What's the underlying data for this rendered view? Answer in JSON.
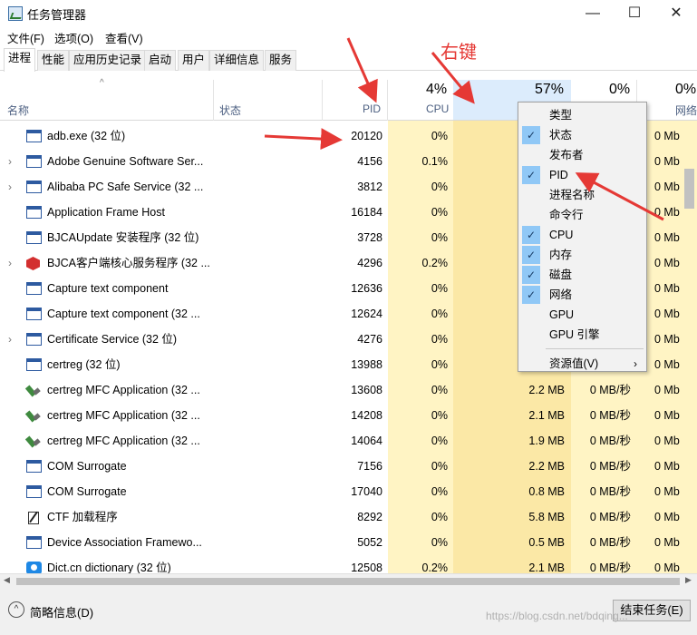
{
  "window": {
    "title": "任务管理器",
    "minimize_glyph": "—",
    "maximize_glyph": "☐",
    "close_glyph": "✕"
  },
  "menu": [
    "文件(F)",
    "选项(O)",
    "查看(V)"
  ],
  "tabs": [
    "进程",
    "性能",
    "应用历史记录",
    "启动",
    "用户",
    "详细信息",
    "服务"
  ],
  "columns": {
    "name": "名称",
    "status": "状态",
    "pid": "PID",
    "cpu_pct": "4%",
    "cpu": "CPU",
    "mem_pct": "57%",
    "disk_pct": "0%",
    "net_pct": "0%",
    "net": "网络"
  },
  "processes": [
    {
      "name": "adb.exe (32 位)",
      "pid": "20120",
      "cpu": "0%",
      "mem": "",
      "disk": "",
      "net": "0 Mb",
      "expandable": false,
      "icon": "window"
    },
    {
      "name": "Adobe Genuine Software Ser...",
      "pid": "4156",
      "cpu": "0.1%",
      "mem": "",
      "disk": "",
      "net": "0 Mb",
      "expandable": true,
      "icon": "window"
    },
    {
      "name": "Alibaba PC Safe Service (32 ...",
      "pid": "3812",
      "cpu": "0%",
      "mem": "",
      "disk": "",
      "net": "0 Mb",
      "expandable": true,
      "icon": "window"
    },
    {
      "name": "Application Frame Host",
      "pid": "16184",
      "cpu": "0%",
      "mem": "",
      "disk": "",
      "net": "0 Mb",
      "expandable": false,
      "icon": "window"
    },
    {
      "name": "BJCAUpdate 安装程序 (32 位)",
      "pid": "3728",
      "cpu": "0%",
      "mem": "",
      "disk": "",
      "net": "0 Mb",
      "expandable": false,
      "icon": "window"
    },
    {
      "name": "BJCA客户端核心服务程序 (32 ...",
      "pid": "4296",
      "cpu": "0.2%",
      "mem": "",
      "disk": "",
      "net": "0 Mb",
      "expandable": true,
      "icon": "red"
    },
    {
      "name": "Capture text component",
      "pid": "12636",
      "cpu": "0%",
      "mem": "",
      "disk": "",
      "net": "0 Mb",
      "expandable": false,
      "icon": "window"
    },
    {
      "name": "Capture text component (32 ...",
      "pid": "12624",
      "cpu": "0%",
      "mem": "",
      "disk": "",
      "net": "0 Mb",
      "expandable": false,
      "icon": "window"
    },
    {
      "name": "Certificate Service (32 位)",
      "pid": "4276",
      "cpu": "0%",
      "mem": "",
      "disk": "",
      "net": "0 Mb",
      "expandable": true,
      "icon": "window"
    },
    {
      "name": "certreg (32 位)",
      "pid": "13988",
      "cpu": "0%",
      "mem": "",
      "disk": "",
      "net": "0 Mb",
      "expandable": false,
      "icon": "window"
    },
    {
      "name": "certreg MFC Application (32 ...",
      "pid": "13608",
      "cpu": "0%",
      "mem": "2.2 MB",
      "disk": "0 MB/秒",
      "net": "0 Mb",
      "expandable": false,
      "icon": "tool"
    },
    {
      "name": "certreg MFC Application (32 ...",
      "pid": "14208",
      "cpu": "0%",
      "mem": "2.1 MB",
      "disk": "0 MB/秒",
      "net": "0 Mb",
      "expandable": false,
      "icon": "tool"
    },
    {
      "name": "certreg MFC Application (32 ...",
      "pid": "14064",
      "cpu": "0%",
      "mem": "1.9 MB",
      "disk": "0 MB/秒",
      "net": "0 Mb",
      "expandable": false,
      "icon": "tool"
    },
    {
      "name": "COM Surrogate",
      "pid": "7156",
      "cpu": "0%",
      "mem": "2.2 MB",
      "disk": "0 MB/秒",
      "net": "0 Mb",
      "expandable": false,
      "icon": "window"
    },
    {
      "name": "COM Surrogate",
      "pid": "17040",
      "cpu": "0%",
      "mem": "0.8 MB",
      "disk": "0 MB/秒",
      "net": "0 Mb",
      "expandable": false,
      "icon": "window"
    },
    {
      "name": "CTF 加载程序",
      "pid": "8292",
      "cpu": "0%",
      "mem": "5.8 MB",
      "disk": "0 MB/秒",
      "net": "0 Mb",
      "expandable": false,
      "icon": "ctf"
    },
    {
      "name": "Device Association Framewo...",
      "pid": "5052",
      "cpu": "0%",
      "mem": "0.5 MB",
      "disk": "0 MB/秒",
      "net": "0 Mb",
      "expandable": false,
      "icon": "window"
    },
    {
      "name": "Dict.cn dictionary (32 位)",
      "pid": "12508",
      "cpu": "0.2%",
      "mem": "2.1 MB",
      "disk": "0 MB/秒",
      "net": "0 Mb",
      "expandable": false,
      "icon": "dict"
    }
  ],
  "context_menu": [
    {
      "label": "类型",
      "checked": false
    },
    {
      "label": "状态",
      "checked": true
    },
    {
      "label": "发布者",
      "checked": false
    },
    {
      "label": "PID",
      "checked": true
    },
    {
      "label": "进程名称",
      "checked": false
    },
    {
      "label": "命令行",
      "checked": false
    },
    {
      "label": "CPU",
      "checked": true
    },
    {
      "label": "内存",
      "checked": true
    },
    {
      "label": "磁盘",
      "checked": true
    },
    {
      "label": "网络",
      "checked": true
    },
    {
      "label": "GPU",
      "checked": false
    },
    {
      "label": "GPU 引擎",
      "checked": false
    },
    {
      "label": "资源值(V)",
      "checked": false,
      "submenu": true
    }
  ],
  "annotation": {
    "text": "右键",
    "color": "#e53935"
  },
  "footer": {
    "fewer_details": "简略信息(D)",
    "end_task": "结束任务(E)"
  },
  "watermark": "https://blog.csdn.net/bdqing..."
}
